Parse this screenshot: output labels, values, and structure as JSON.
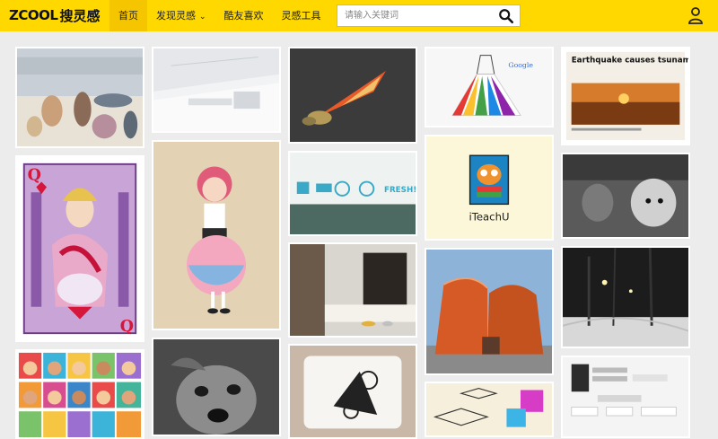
{
  "header": {
    "logo_latin": "ZCOOL",
    "logo_cn": "搜灵感",
    "nav": [
      {
        "label": "首页",
        "active": true
      },
      {
        "label": "发现灵感",
        "has_caret": true
      },
      {
        "label": "酷友喜欢"
      },
      {
        "label": "灵感工具"
      }
    ],
    "search": {
      "placeholder": "请输入关键词",
      "icon": "search-icon"
    },
    "user_icon": "user-icon"
  },
  "tiles": {
    "earthquake_headline": "Earthquake causes tsunami fears",
    "iteachu_label": "iTeachU",
    "freshi_label": "FRESH!",
    "google_label": "Google"
  },
  "colors": {
    "brand_yellow": "#ffd800",
    "page_bg": "#ececec"
  }
}
